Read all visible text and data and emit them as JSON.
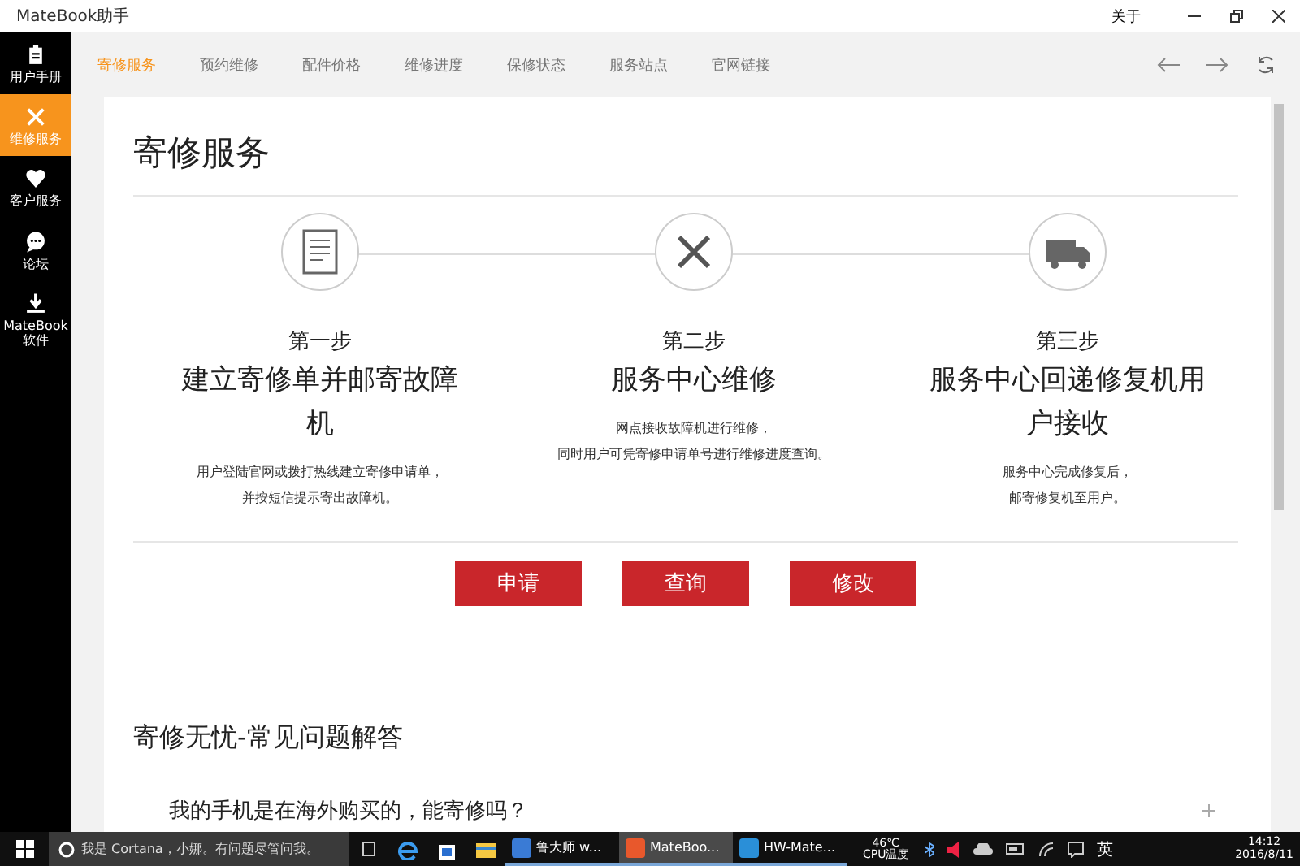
{
  "window": {
    "title": "MateBook助手",
    "about": "关于"
  },
  "sidebar": {
    "items": [
      {
        "label": "用户手册",
        "selected": false
      },
      {
        "label": "维修服务",
        "selected": true
      },
      {
        "label": "客户服务",
        "selected": false
      },
      {
        "label": "论坛",
        "selected": false
      },
      {
        "label": "MateBook 软件",
        "selected": false
      }
    ]
  },
  "tabs": [
    {
      "label": "寄修服务",
      "selected": true
    },
    {
      "label": "预约维修",
      "selected": false
    },
    {
      "label": "配件价格",
      "selected": false
    },
    {
      "label": "维修进度",
      "selected": false
    },
    {
      "label": "保修状态",
      "selected": false
    },
    {
      "label": "服务站点",
      "selected": false
    },
    {
      "label": "官网链接",
      "selected": false
    }
  ],
  "page": {
    "heading": "寄修服务",
    "steps": [
      {
        "step": "第一步",
        "title": "建立寄修单并邮寄故障机",
        "description": [
          "用户登陆官网或拨打热线建立寄修申请单，",
          "并按短信提示寄出故障机。"
        ]
      },
      {
        "step": "第二步",
        "title": "服务中心维修",
        "description": [
          "网点接收故障机进行维修，",
          "同时用户可凭寄修申请单号进行维修进度查询。"
        ]
      },
      {
        "step": "第三步",
        "title": "服务中心回递修复机用户接收",
        "description": [
          "服务中心完成修复后，",
          "邮寄修复机至用户。"
        ]
      }
    ],
    "buttons": [
      "申请",
      "查询",
      "修改"
    ],
    "faq_heading": "寄修无忧-常见问题解答",
    "faq": [
      {
        "question": "我的手机是在海外购买的，能寄修吗？",
        "expanded": false
      }
    ]
  },
  "taskbar": {
    "search_placeholder": "我是 Cortana，小娜。有问题尽管问我。",
    "apps": [
      {
        "label": "鲁大师 w...",
        "selected": false,
        "color": "#3a7bd5"
      },
      {
        "label": "MateBoo...",
        "selected": true,
        "color": "#e8582c"
      },
      {
        "label": "HW-Mate...",
        "selected": false,
        "color": "#2a8fd8"
      }
    ],
    "temperature": "46℃",
    "temperature_label": "CPU温度",
    "ime": "英",
    "time": "14:12",
    "date": "2016/8/11"
  }
}
